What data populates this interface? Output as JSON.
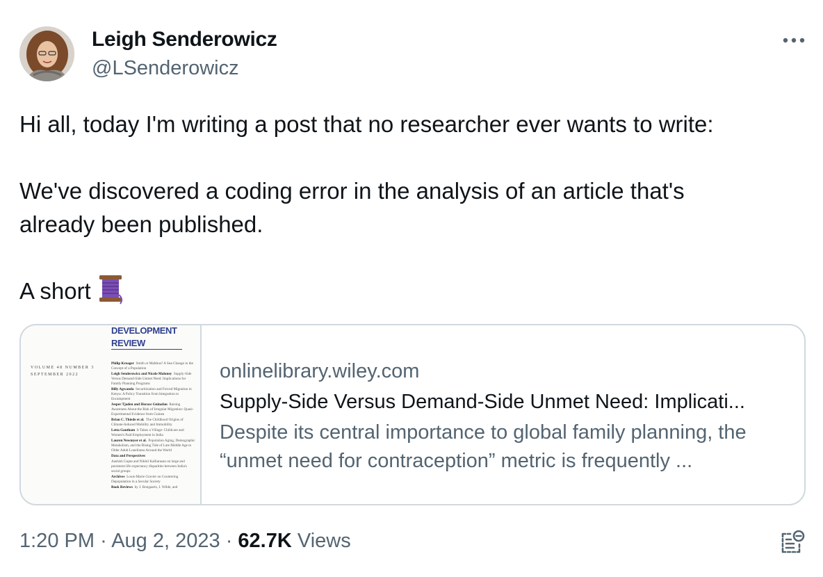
{
  "author": {
    "name": "Leigh Senderowicz",
    "handle": "@LSenderowicz"
  },
  "header": {
    "more_icon": "more-horizontal-icon"
  },
  "tweet": {
    "line1": "Hi all, today I'm writing a post that no researcher ever wants to write:",
    "line2": "We've discovered a coding error in the analysis of an article that's",
    "line3": "already been published.",
    "line4": "A short",
    "emoji": "spool-of-thread-icon"
  },
  "card": {
    "domain": "onlinelibrary.wiley.com",
    "title": "Supply-Side Versus Demand-Side Unmet Need: Implicati...",
    "description_line1": "Despite its central importance to global family planning, the",
    "description_line2": "“unmet need for contraception” metric is frequently ...",
    "thumbnail": {
      "title_line1": "DEVELOPMENT",
      "title_line2": "REVIEW",
      "volume": "VOLUME 48    NUMBER 3",
      "date": "SEPTEMBER 2022",
      "contents": [
        {
          "author": "Philip Kreager",
          "title": "Smith or Malthus? A Sea-Change in the Concept of a Population"
        },
        {
          "author": "Leigh Senderowicz and Nicole Maloney",
          "title": "Supply-Side Versus Demand-Side Unmet Need: Implications for Family Planning Programs"
        },
        {
          "author": "Billy Agwanda",
          "title": "Securitization and Forced Migration in Kenya: A Policy Transition from Integration to Encampment"
        },
        {
          "author": "Jesper Tjaden and Horace Gninafon",
          "title": "Raising Awareness About the Risk of Irregular Migration: Quasi-Experimental Evidence from Guinea"
        },
        {
          "author": "Brian C. Thiede et al.",
          "title": "The Childhood Origins of Climate-Induced Mobility and Immobility"
        },
        {
          "author": "Letta Gautham",
          "title": "It Takes a Village: Childcare and Women's Paid Employment in India"
        },
        {
          "author": "Lauren Newmyer et al.",
          "title": "Population Aging, Demographic Metabolism, and the Rising Tide of Late Middle Age to Older Adult Loneliness Around the World"
        },
        {
          "author": "Data and Perspectives",
          "title": ""
        },
        {
          "author": "",
          "title": "Aashish Gupta and Nikhil Kalliarasan on large and persistent life expectancy disparities between India's social groups"
        },
        {
          "author": "Archives",
          "title": "Louis-Marie Gravier on Countering Depopulation in a Secular Society"
        },
        {
          "author": "Book Reviews",
          "title": "by J. Bongaarts, J. Wilde, and"
        }
      ]
    }
  },
  "meta": {
    "time": "1:20 PM",
    "separator": "·",
    "date": "Aug 2, 2023",
    "views_count": "62.7K",
    "views_label": "Views"
  },
  "footer": {
    "notes_icon": "community-notes-icon"
  },
  "colors": {
    "text": "#0f1419",
    "secondary": "#536471",
    "border": "#cfd9de",
    "cover_title": "#2f3f8f"
  }
}
